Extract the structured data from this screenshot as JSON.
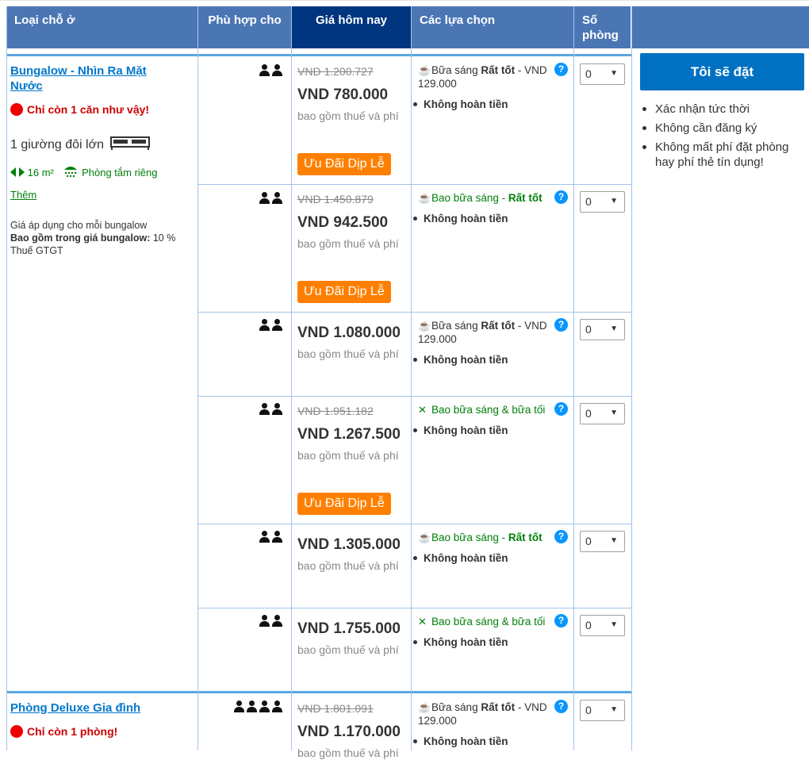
{
  "header": {
    "room_type": "Loại chỗ ở",
    "sleeps": "Phù hợp cho",
    "price_today": "Giá hôm nay",
    "choices": "Các lựa chọn",
    "rooms": "Số phòng"
  },
  "book_button": "Tôi sẽ đặt",
  "benefits": [
    "Xác nhận tức thời",
    "Không cần đăng ký",
    "Không mất phí đặt phòng hay phí thẻ tín dụng!"
  ],
  "room1": {
    "name": "Bungalow - Nhìn Ra Mặt Nước",
    "availability": "Chỉ còn 1 căn như vậy!",
    "bed": "1 giường đôi lớn",
    "size": "16 m²",
    "bathroom": "Phòng tắm riêng",
    "more": "Thêm",
    "price_note": "Giá áp dụng cho mỗi bungalow",
    "included_label": "Bao gồm trong giá bungalow:",
    "included_value": "10 % Thuế GTGT"
  },
  "room2": {
    "name": "Phòng Deluxe Gia đình",
    "availability": "Chỉ còn 1 phòng!"
  },
  "common": {
    "incl_taxes": "bao gồm thuế và phí",
    "promo": "Ưu Đãi Dịp Lễ",
    "non_refundable": "Không hoàn tiền",
    "select_value": "0"
  },
  "rates": [
    {
      "strike": "VND 1.200.727",
      "price": "VND 780.000",
      "meal_prefix": "Bữa sáng",
      "meal_good": "Rất tốt",
      "meal_suffix": " - VND 129.000",
      "meal_icon": "coffee-icon"
    },
    {
      "strike": "VND 1.450.879",
      "price": "VND 942.500",
      "meal_prefix": "Bao bữa sáng - ",
      "meal_good": "Rất tốt",
      "meal_suffix": "",
      "meal_icon": "coffee-icon"
    },
    {
      "strike": "",
      "price": "VND 1.080.000",
      "meal_prefix": "Bữa sáng",
      "meal_good": "Rất tốt",
      "meal_suffix": " - VND 129.000",
      "meal_icon": "coffee-icon"
    },
    {
      "strike": "VND 1.951.182",
      "price": "VND 1.267.500",
      "meal_prefix": "Bao bữa sáng & bữa tối",
      "meal_good": "",
      "meal_suffix": "",
      "meal_icon": "cutlery-icon"
    },
    {
      "strike": "",
      "price": "VND 1.305.000",
      "meal_prefix": "Bao bữa sáng - ",
      "meal_good": "Rất tốt",
      "meal_suffix": "",
      "meal_icon": "coffee-icon"
    },
    {
      "strike": "",
      "price": "VND 1.755.000",
      "meal_prefix": "Bao bữa sáng & bữa tối",
      "meal_good": "",
      "meal_suffix": "",
      "meal_icon": "cutlery-icon"
    },
    {
      "strike": "VND 1.801.091",
      "price": "VND 1.170.000",
      "meal_prefix": "Bữa sáng",
      "meal_good": "Rất tốt",
      "meal_suffix": " - VND 129.000",
      "meal_icon": "coffee-icon"
    }
  ],
  "colors": {
    "header": "#4b76b4",
    "header_selected": "#003580",
    "promo": "#ff8000",
    "book_button": "#0071c2",
    "link": "#0077cc"
  }
}
